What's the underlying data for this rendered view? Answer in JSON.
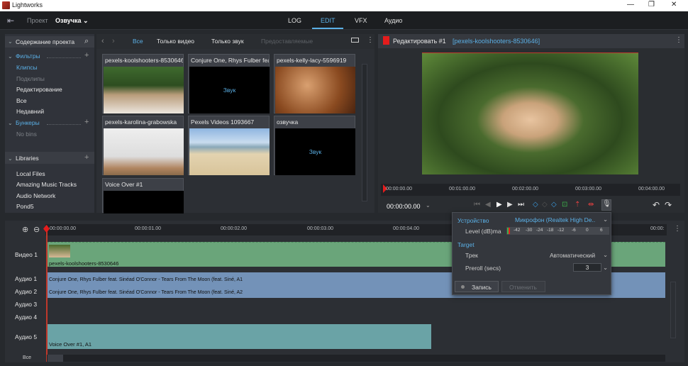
{
  "window": {
    "title": "Lightworks",
    "min": "—",
    "max": "❐",
    "close": "✕"
  },
  "menubar": {
    "exit_icon": "exit-icon",
    "project_label": "Проект",
    "project_name": "Озвучка ⌄",
    "tabs": [
      {
        "label": "LOG"
      },
      {
        "label": "EDIT",
        "active": true
      },
      {
        "label": "VFX"
      },
      {
        "label": "Аудио"
      }
    ]
  },
  "sidebar": {
    "title": "Содержание проекта",
    "filters_label": "Фильтры",
    "filters": [
      "Клипсы",
      "Подклипы",
      "Редактирование",
      "Все",
      "Недавний"
    ],
    "bins_label": "Бункеры",
    "no_bins": "No bins",
    "libraries_label": "Libraries",
    "libraries": [
      "Local Files",
      "Amazing Music Tracks",
      "Audio Network",
      "Pond5"
    ]
  },
  "browser": {
    "filters": [
      "Все",
      "Только видео",
      "Только звук",
      "Предоставляемые"
    ],
    "tiles": [
      {
        "name": "pexels-koolshooters-8530646",
        "kind": "video"
      },
      {
        "name": "Conjure One, Rhys Fulber feat.",
        "kind": "audio",
        "audio_label": "Звук"
      },
      {
        "name": "pexels-kelly-lacy-5596919",
        "kind": "video"
      },
      {
        "name": "pexels-karolina-grabowska",
        "kind": "video"
      },
      {
        "name": "Pexels Videos 1093667",
        "kind": "video"
      },
      {
        "name": "озвучка",
        "kind": "audio",
        "audio_label": "Звук"
      },
      {
        "name": "Voice Over #1",
        "kind": "black"
      }
    ]
  },
  "viewer": {
    "title": "Редактировать #1",
    "clip": "[pexels-koolshooters-8530646]",
    "ruler": [
      "00:00:00.00",
      "00:01:00.00",
      "00:02:00.00",
      "00:03:00.00",
      "00:04:00.00"
    ],
    "timecode": "00:00:00.00"
  },
  "voiceover": {
    "device_label": "Устройство",
    "device_value": "Микрофон (Realtek High De..",
    "level_label": "Level (dB)ma",
    "level_ticks": [
      "-42",
      "-30",
      "-24",
      "-18",
      "-12",
      "-6",
      "0",
      "6"
    ],
    "target_label": "Target",
    "track_label": "Трек",
    "track_value": "Автоматический",
    "preroll_label": "Preroll (secs)",
    "preroll_value": "3",
    "record": "Запись",
    "cancel": "Отменить"
  },
  "timeline": {
    "ruler": [
      "00:00:00.00",
      "00:00:01.00",
      "00:00:02.00",
      "00:00:03.00",
      "00:00:04.00",
      "00:00:"
    ],
    "tracks": [
      "Видео 1",
      "Аудио 1",
      "Аудио 2",
      "Аудио 3",
      "Аудио 4",
      "Аудио 5"
    ],
    "clips": {
      "video": "pexels-koolshooters-8530646",
      "a1": "Conjure One, Rhys Fulber feat. Sinéad O'Connor - Tears From The Moon (feat. Siné, A1",
      "a2": "Conjure One, Rhys Fulber feat. Sinéad O'Connor - Tears From The Moon (feat. Siné, A2",
      "a5": "Voice Over #1, A1"
    },
    "all_label": "Все"
  }
}
